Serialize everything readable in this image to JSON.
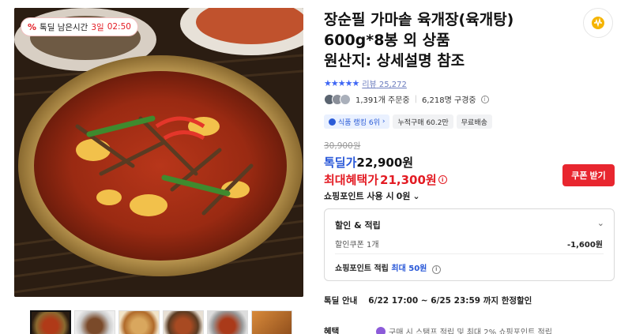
{
  "timer": {
    "icon": "percent-tag-icon",
    "label": "톡딜 남은시간",
    "days": "3일",
    "time": "02:50"
  },
  "product": {
    "title_line1": "장순필 가마솥 육개장(육개탕)",
    "title_line2": "600g*8봉 외 상품",
    "title_line3": "원산지: 상세설명 참조"
  },
  "rating": {
    "stars": "★★★★★",
    "review_label": "리뷰",
    "review_count": "25,272"
  },
  "buyers": {
    "orders": "1,391개 주문중",
    "viewers": "6,218명 구경중"
  },
  "tags": [
    "식품 랭킹 6위",
    "누적구매 60.2만",
    "무료배송"
  ],
  "price": {
    "original": "30,900원",
    "deal_label": "톡딜가",
    "deal_value": "22,900원",
    "max_label": "최대혜택가",
    "max_value": "21,300원",
    "info_icon": "i"
  },
  "coupon_button": "쿠폰 받기",
  "point_select": "쇼핑포인트 사용 시",
  "point_select_value": "0원",
  "discount": {
    "title": "할인 & 적립",
    "coupon_label": "할인쿠폰 1개",
    "coupon_value": "-1,600원",
    "points_label": "쇼핑포인트 적립",
    "points_max": "최대 50원"
  },
  "deal_info": {
    "label": "톡딜 안내",
    "period": "6/22 17:00 ~ 6/25 23:59 까지 한정할인"
  },
  "benefit": {
    "label": "혜택",
    "text": "구매 시 스탬프 적립 및 최대 2% 쇼핑포인트 적립"
  },
  "colors": {
    "accent_red": "#e31b23",
    "accent_blue": "#2958d8",
    "button_red": "#e8262f"
  }
}
